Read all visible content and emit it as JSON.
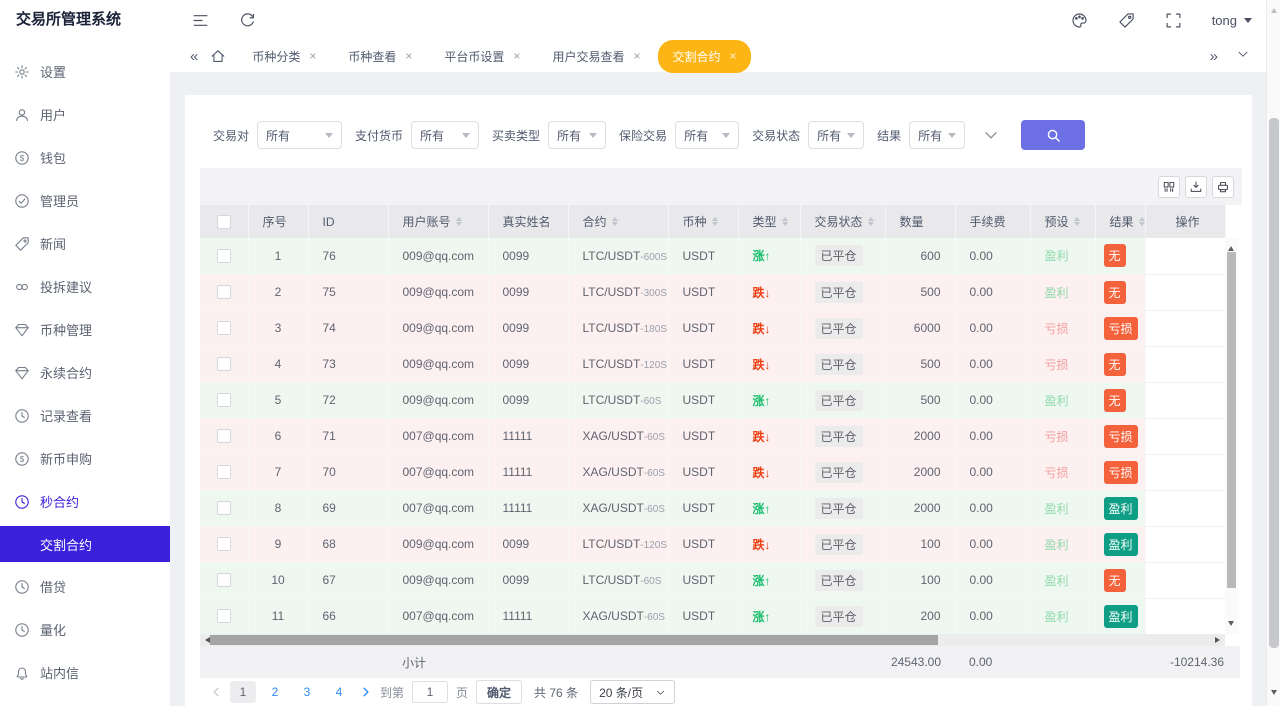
{
  "app": {
    "title": "交易所管理系统",
    "user": "tong"
  },
  "colors": {
    "accent": "#3b20dc",
    "tab_active_bg": "#fdb515",
    "rise_green": "#19be6b",
    "fall_red": "#ed4014",
    "badge_orange": "#f4623c",
    "badge_teal": "#0e9e85",
    "link_blue": "#2d8cf0"
  },
  "topbar": {
    "left_icons": [
      "menu-fold",
      "refresh"
    ],
    "right_icons": [
      "palette",
      "tag",
      "fullscreen"
    ]
  },
  "tabbar": {
    "tabs": [
      {
        "label": "币种分类",
        "active": false
      },
      {
        "label": "币种查看",
        "active": false
      },
      {
        "label": "平台币设置",
        "active": false
      },
      {
        "label": "用户交易查看",
        "active": false
      },
      {
        "label": "交割合约",
        "active": true
      }
    ]
  },
  "sidebar": {
    "items": [
      {
        "key": "settings",
        "icon": "gear",
        "label": "设置"
      },
      {
        "key": "users",
        "icon": "user",
        "label": "用户"
      },
      {
        "key": "wallet",
        "icon": "dollar-circle",
        "label": "钱包"
      },
      {
        "key": "admins",
        "icon": "check-circle",
        "label": "管理员"
      },
      {
        "key": "news",
        "icon": "tag",
        "label": "新闻"
      },
      {
        "key": "feedback",
        "icon": "link",
        "label": "投拆建议"
      },
      {
        "key": "coin-manage",
        "icon": "gem",
        "label": "币种管理"
      },
      {
        "key": "perpetual",
        "icon": "gem",
        "label": "永续合约"
      },
      {
        "key": "records",
        "icon": "clock",
        "label": "记录查看"
      },
      {
        "key": "new-coin",
        "icon": "dollar-circle",
        "label": "新币申购"
      },
      {
        "key": "second-contract",
        "icon": "clock",
        "label": "秒合约",
        "state": "parent-active"
      },
      {
        "key": "delivery-contract",
        "label": "交割合约",
        "state": "active",
        "submenu": true
      },
      {
        "key": "lending",
        "icon": "clock",
        "label": "借贷"
      },
      {
        "key": "quant",
        "icon": "clock",
        "label": "量化"
      },
      {
        "key": "messages",
        "icon": "bell",
        "label": "站内信"
      }
    ]
  },
  "filters": [
    {
      "label": "交易对",
      "value": "所有"
    },
    {
      "label": "支付货币",
      "value": "所有"
    },
    {
      "label": "买卖类型",
      "value": "所有"
    },
    {
      "label": "保险交易",
      "value": "所有"
    },
    {
      "label": "交易状态",
      "value": "所有"
    },
    {
      "label": "结果",
      "value": "所有"
    }
  ],
  "table_toolbar": {
    "buttons": [
      "column-settings",
      "export",
      "print"
    ]
  },
  "table": {
    "columns": [
      {
        "key": "select",
        "label": "",
        "type": "checkbox"
      },
      {
        "key": "seq",
        "label": "序号"
      },
      {
        "key": "id",
        "label": "ID"
      },
      {
        "key": "account",
        "label": "用户账号",
        "sortable": true
      },
      {
        "key": "name",
        "label": "真实姓名"
      },
      {
        "key": "contract",
        "label": "合约",
        "sortable": true
      },
      {
        "key": "coin",
        "label": "币种",
        "sortable": true
      },
      {
        "key": "type",
        "label": "类型",
        "sortable": true
      },
      {
        "key": "status",
        "label": "交易状态",
        "sortable": true
      },
      {
        "key": "qty",
        "label": "数量"
      },
      {
        "key": "fee",
        "label": "手续费"
      },
      {
        "key": "preset",
        "label": "预设",
        "sortable": true
      },
      {
        "key": "result",
        "label": "结果",
        "sortable": true
      },
      {
        "key": "op",
        "label": "操作"
      }
    ],
    "rows": [
      {
        "seq": "1",
        "id": "76",
        "account": "009@qq.com",
        "name": "0099",
        "contract": "LTC/USDT",
        "period": "600S",
        "coin": "USDT",
        "type": "涨",
        "trend": "up",
        "status": "已平仓",
        "qty": "600",
        "fee": "0.00",
        "preset": "盈利",
        "preset_kind": "profit",
        "result": "无",
        "result_kind": "none"
      },
      {
        "seq": "2",
        "id": "75",
        "account": "009@qq.com",
        "name": "0099",
        "contract": "LTC/USDT",
        "period": "300S",
        "coin": "USDT",
        "type": "跌",
        "trend": "down",
        "status": "已平仓",
        "qty": "500",
        "fee": "0.00",
        "preset": "盈利",
        "preset_kind": "profit",
        "result": "无",
        "result_kind": "none"
      },
      {
        "seq": "3",
        "id": "74",
        "account": "009@qq.com",
        "name": "0099",
        "contract": "LTC/USDT",
        "period": "180S",
        "coin": "USDT",
        "type": "跌",
        "trend": "down",
        "status": "已平仓",
        "qty": "6000",
        "fee": "0.00",
        "preset": "亏损",
        "preset_kind": "loss",
        "result": "亏损",
        "result_kind": "loss"
      },
      {
        "seq": "4",
        "id": "73",
        "account": "009@qq.com",
        "name": "0099",
        "contract": "LTC/USDT",
        "period": "120S",
        "coin": "USDT",
        "type": "跌",
        "trend": "down",
        "status": "已平仓",
        "qty": "500",
        "fee": "0.00",
        "preset": "亏损",
        "preset_kind": "loss",
        "result": "无",
        "result_kind": "none"
      },
      {
        "seq": "5",
        "id": "72",
        "account": "009@qq.com",
        "name": "0099",
        "contract": "LTC/USDT",
        "period": "60S",
        "coin": "USDT",
        "type": "涨",
        "trend": "up",
        "status": "已平仓",
        "qty": "500",
        "fee": "0.00",
        "preset": "盈利",
        "preset_kind": "profit",
        "result": "无",
        "result_kind": "none"
      },
      {
        "seq": "6",
        "id": "71",
        "account": "007@qq.com",
        "name": "11111",
        "contract": "XAG/USDT",
        "period": "60S",
        "coin": "USDT",
        "type": "跌",
        "trend": "down",
        "status": "已平仓",
        "qty": "2000",
        "fee": "0.00",
        "preset": "亏损",
        "preset_kind": "loss",
        "result": "亏损",
        "result_kind": "loss"
      },
      {
        "seq": "7",
        "id": "70",
        "account": "007@qq.com",
        "name": "11111",
        "contract": "XAG/USDT",
        "period": "60S",
        "coin": "USDT",
        "type": "跌",
        "trend": "down",
        "status": "已平仓",
        "qty": "2000",
        "fee": "0.00",
        "preset": "亏损",
        "preset_kind": "loss",
        "result": "亏损",
        "result_kind": "loss"
      },
      {
        "seq": "8",
        "id": "69",
        "account": "007@qq.com",
        "name": "11111",
        "contract": "XAG/USDT",
        "period": "60S",
        "coin": "USDT",
        "type": "涨",
        "trend": "up",
        "status": "已平仓",
        "qty": "2000",
        "fee": "0.00",
        "preset": "盈利",
        "preset_kind": "profit",
        "result": "盈利",
        "result_kind": "profit"
      },
      {
        "seq": "9",
        "id": "68",
        "account": "009@qq.com",
        "name": "0099",
        "contract": "LTC/USDT",
        "period": "120S",
        "coin": "USDT",
        "type": "跌",
        "trend": "down",
        "status": "已平仓",
        "qty": "100",
        "fee": "0.00",
        "preset": "盈利",
        "preset_kind": "profit",
        "result": "盈利",
        "result_kind": "profit"
      },
      {
        "seq": "10",
        "id": "67",
        "account": "009@qq.com",
        "name": "0099",
        "contract": "LTC/USDT",
        "period": "60S",
        "coin": "USDT",
        "type": "涨",
        "trend": "up",
        "status": "已平仓",
        "qty": "100",
        "fee": "0.00",
        "preset": "盈利",
        "preset_kind": "profit",
        "result": "无",
        "result_kind": "none"
      },
      {
        "seq": "11",
        "id": "66",
        "account": "007@qq.com",
        "name": "11111",
        "contract": "XAG/USDT",
        "period": "60S",
        "coin": "USDT",
        "type": "涨",
        "trend": "up",
        "status": "已平仓",
        "qty": "200",
        "fee": "0.00",
        "preset": "盈利",
        "preset_kind": "profit",
        "result": "盈利",
        "result_kind": "profit"
      }
    ],
    "summary": {
      "label": "小计",
      "qty": "24543.00",
      "fee": "0.00",
      "result_total": "-10214.36"
    }
  },
  "pagination": {
    "pages": [
      "1",
      "2",
      "3",
      "4"
    ],
    "current": "1",
    "goto_label": "到第",
    "page_input": "1",
    "page_unit": "页",
    "confirm_label": "确定",
    "total_label": "共 76 条",
    "page_size_label": "20 条/页"
  }
}
